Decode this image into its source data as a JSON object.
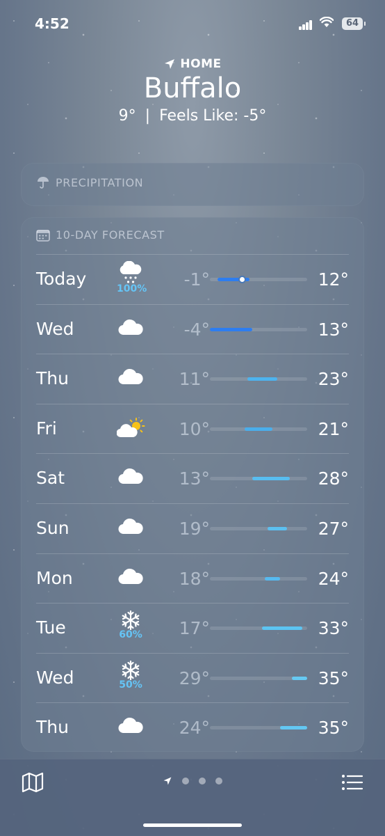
{
  "status_bar": {
    "time": "4:52",
    "battery": "64"
  },
  "header": {
    "location_label": "HOME",
    "city": "Buffalo",
    "current_temp": "9°",
    "separator": "|",
    "feels_like": "Feels Like: -5°"
  },
  "precipitation_card": {
    "title": "PRECIPITATION",
    "icon": "umbrella-icon"
  },
  "forecast_card": {
    "title": "10-DAY FORECAST",
    "icon": "calendar-icon",
    "scale": {
      "min": -4,
      "max": 35
    },
    "current_temp_value": 9,
    "days": [
      {
        "day": "Today",
        "icon": "snow-cloud-icon",
        "precip": "100%",
        "low": "-1°",
        "high": "12°",
        "low_val": -1,
        "high_val": 12,
        "bar_color": "#2d7df0",
        "show_dot": true
      },
      {
        "day": "Wed",
        "icon": "cloud-icon",
        "precip": "",
        "low": "-4°",
        "high": "13°",
        "low_val": -4,
        "high_val": 13,
        "bar_color": "#2d7df0"
      },
      {
        "day": "Thu",
        "icon": "cloud-icon",
        "precip": "",
        "low": "11°",
        "high": "23°",
        "low_val": 11,
        "high_val": 23,
        "bar_color": "#4db3ee"
      },
      {
        "day": "Fri",
        "icon": "partly-sunny-icon",
        "precip": "",
        "low": "10°",
        "high": "21°",
        "low_val": 10,
        "high_val": 21,
        "bar_color": "#4aaeeb"
      },
      {
        "day": "Sat",
        "icon": "cloud-icon",
        "precip": "",
        "low": "13°",
        "high": "28°",
        "low_val": 13,
        "high_val": 28,
        "bar_color": "#58bdf0"
      },
      {
        "day": "Sun",
        "icon": "cloud-icon",
        "precip": "",
        "low": "19°",
        "high": "27°",
        "low_val": 19,
        "high_val": 27,
        "bar_color": "#5cc0f0"
      },
      {
        "day": "Mon",
        "icon": "cloud-icon",
        "precip": "",
        "low": "18°",
        "high": "24°",
        "low_val": 18,
        "high_val": 24,
        "bar_color": "#56baf0"
      },
      {
        "day": "Tue",
        "icon": "snowflake-icon",
        "precip": "60%",
        "low": "17°",
        "high": "33°",
        "low_val": 17,
        "high_val": 33,
        "bar_color": "#5cc4f2"
      },
      {
        "day": "Wed",
        "icon": "snowflake-icon",
        "precip": "50%",
        "low": "29°",
        "high": "35°",
        "low_val": 29,
        "high_val": 35,
        "bar_color": "#66c9f2"
      },
      {
        "day": "Thu",
        "icon": "cloud-icon",
        "precip": "",
        "low": "24°",
        "high": "35°",
        "low_val": 24,
        "high_val": 35,
        "bar_color": "#63c7f2"
      }
    ]
  },
  "bottom_bar": {
    "map_icon": "map-icon",
    "list_icon": "list-icon",
    "pages": 3,
    "current_page": "location-arrow-icon"
  }
}
